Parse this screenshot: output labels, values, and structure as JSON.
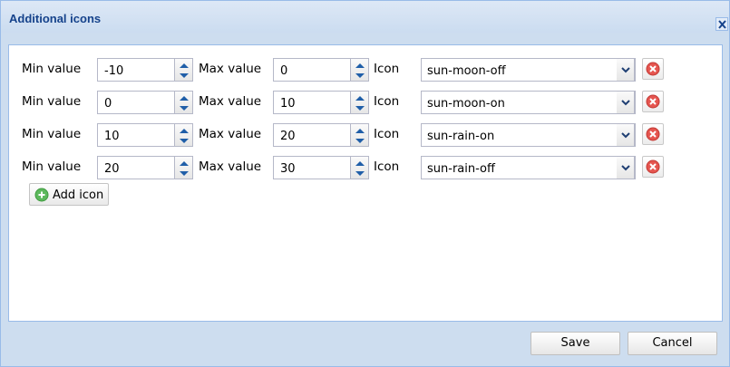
{
  "window": {
    "title": "Additional icons"
  },
  "labels": {
    "min": "Min value",
    "max": "Max value",
    "icon": "Icon"
  },
  "rows": [
    {
      "min": "-10",
      "max": "0",
      "icon": "sun-moon-off"
    },
    {
      "min": "0",
      "max": "10",
      "icon": "sun-moon-on"
    },
    {
      "min": "10",
      "max": "20",
      "icon": "sun-rain-on"
    },
    {
      "min": "20",
      "max": "30",
      "icon": "sun-rain-off"
    }
  ],
  "buttons": {
    "add_icon": "Add icon",
    "save": "Save",
    "cancel": "Cancel"
  },
  "icons": {
    "close": "close-icon",
    "spinner": "spinner-arrows-icon",
    "dropdown": "chevron-down-icon",
    "delete": "delete-circle-icon",
    "add": "add-circle-icon"
  },
  "colors": {
    "title_text": "#15428b",
    "frame": "#cdddef",
    "border": "#99bbe8",
    "delete_icon": "#e5554f",
    "add_icon": "#5cb85c"
  }
}
